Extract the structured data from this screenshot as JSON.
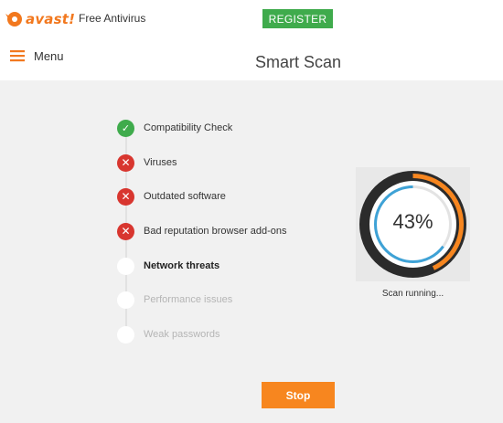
{
  "header": {
    "brand": "avast!",
    "product": "Free Antivirus",
    "register_label": "REGISTER",
    "menu_label": "Menu",
    "title": "Smart Scan"
  },
  "steps": [
    {
      "label": "Compatibility Check",
      "status": "passed",
      "icon": "check-icon"
    },
    {
      "label": "Viruses",
      "status": "issue",
      "icon": "x-icon"
    },
    {
      "label": "Outdated software",
      "status": "issue",
      "icon": "x-icon"
    },
    {
      "label": "Bad reputation browser add-ons",
      "status": "issue",
      "icon": "x-icon"
    },
    {
      "label": "Network threats",
      "status": "scanning",
      "icon": "empty-circle-icon"
    },
    {
      "label": "Performance issues",
      "status": "pending",
      "icon": "empty-circle-icon"
    },
    {
      "label": "Weak passwords",
      "status": "pending",
      "icon": "empty-circle-icon"
    }
  ],
  "scan": {
    "percent_label": "43%",
    "progress": 0.43,
    "status": "Scan running..."
  },
  "stop_label": "Stop",
  "colors": {
    "brand_orange": "#f2781e",
    "register_green": "#3fab4c",
    "ok_green": "#3fab4c",
    "issue_red": "#d8362f",
    "progress_orange": "#f7861f",
    "inner_ring_blue": "#3ea2d6",
    "stop_orange": "#f7861f"
  }
}
